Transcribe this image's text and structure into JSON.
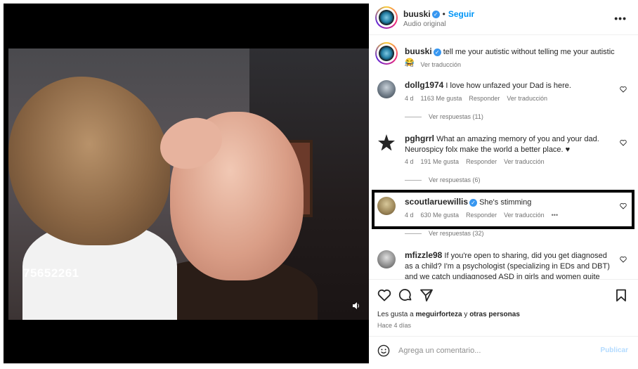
{
  "video": {
    "overlay_number": "75652261",
    "icons": {
      "speaker": "speaker-icon"
    }
  },
  "header": {
    "username": "buuski",
    "dot": "•",
    "follow_label": "Seguir",
    "audio_label": "Audio original",
    "more_label": "•••"
  },
  "caption": {
    "username": "buuski",
    "text": "tell me your autistic without telling me your autistic 😂",
    "time": "4 d",
    "translate": "Ver traducción"
  },
  "comments": [
    {
      "username": "dollg1974",
      "text": "I love how unfazed your Dad is here.",
      "time": "4 d",
      "likes": "1163 Me gusta",
      "reply": "Responder",
      "translate": "Ver traducción",
      "replies": "Ver respuestas (11)"
    },
    {
      "username": "pghgrrl",
      "text": "What an amazing memory of you and your dad. Neurospicy folx make the world a better place. ♥",
      "time": "4 d",
      "likes": "191 Me gusta",
      "reply": "Responder",
      "translate": "Ver traducción",
      "replies": "Ver respuestas (6)"
    },
    {
      "username": "scoutlaruewillis",
      "text": "She's stimming",
      "time": "4 d",
      "likes": "630 Me gusta",
      "reply": "Responder",
      "translate": "Ver traducción",
      "more": "•••",
      "replies": "Ver respuestas (32)"
    },
    {
      "username": "mfizzle98",
      "text": "If you're open to sharing, did you get diagnosed as a child? I'm a psychologist (specializing in EDs and DBT) and we catch undiagnosed ASD in girls and women quite often (they",
      "time": "",
      "likes": "",
      "reply": "",
      "translate": "",
      "replies": ""
    }
  ],
  "actions": {
    "likes_prefix": "Les gusta a",
    "likes_user": "meguirforteza",
    "likes_joiner": "y",
    "likes_others": "otras personas",
    "ago": "Hace 4 días"
  },
  "composer": {
    "placeholder": "Agrega un comentario...",
    "publish_label": "Publicar"
  },
  "colors": {
    "accent": "#0095f6",
    "verified": "#3897f0",
    "highlight_border": "#000000"
  }
}
